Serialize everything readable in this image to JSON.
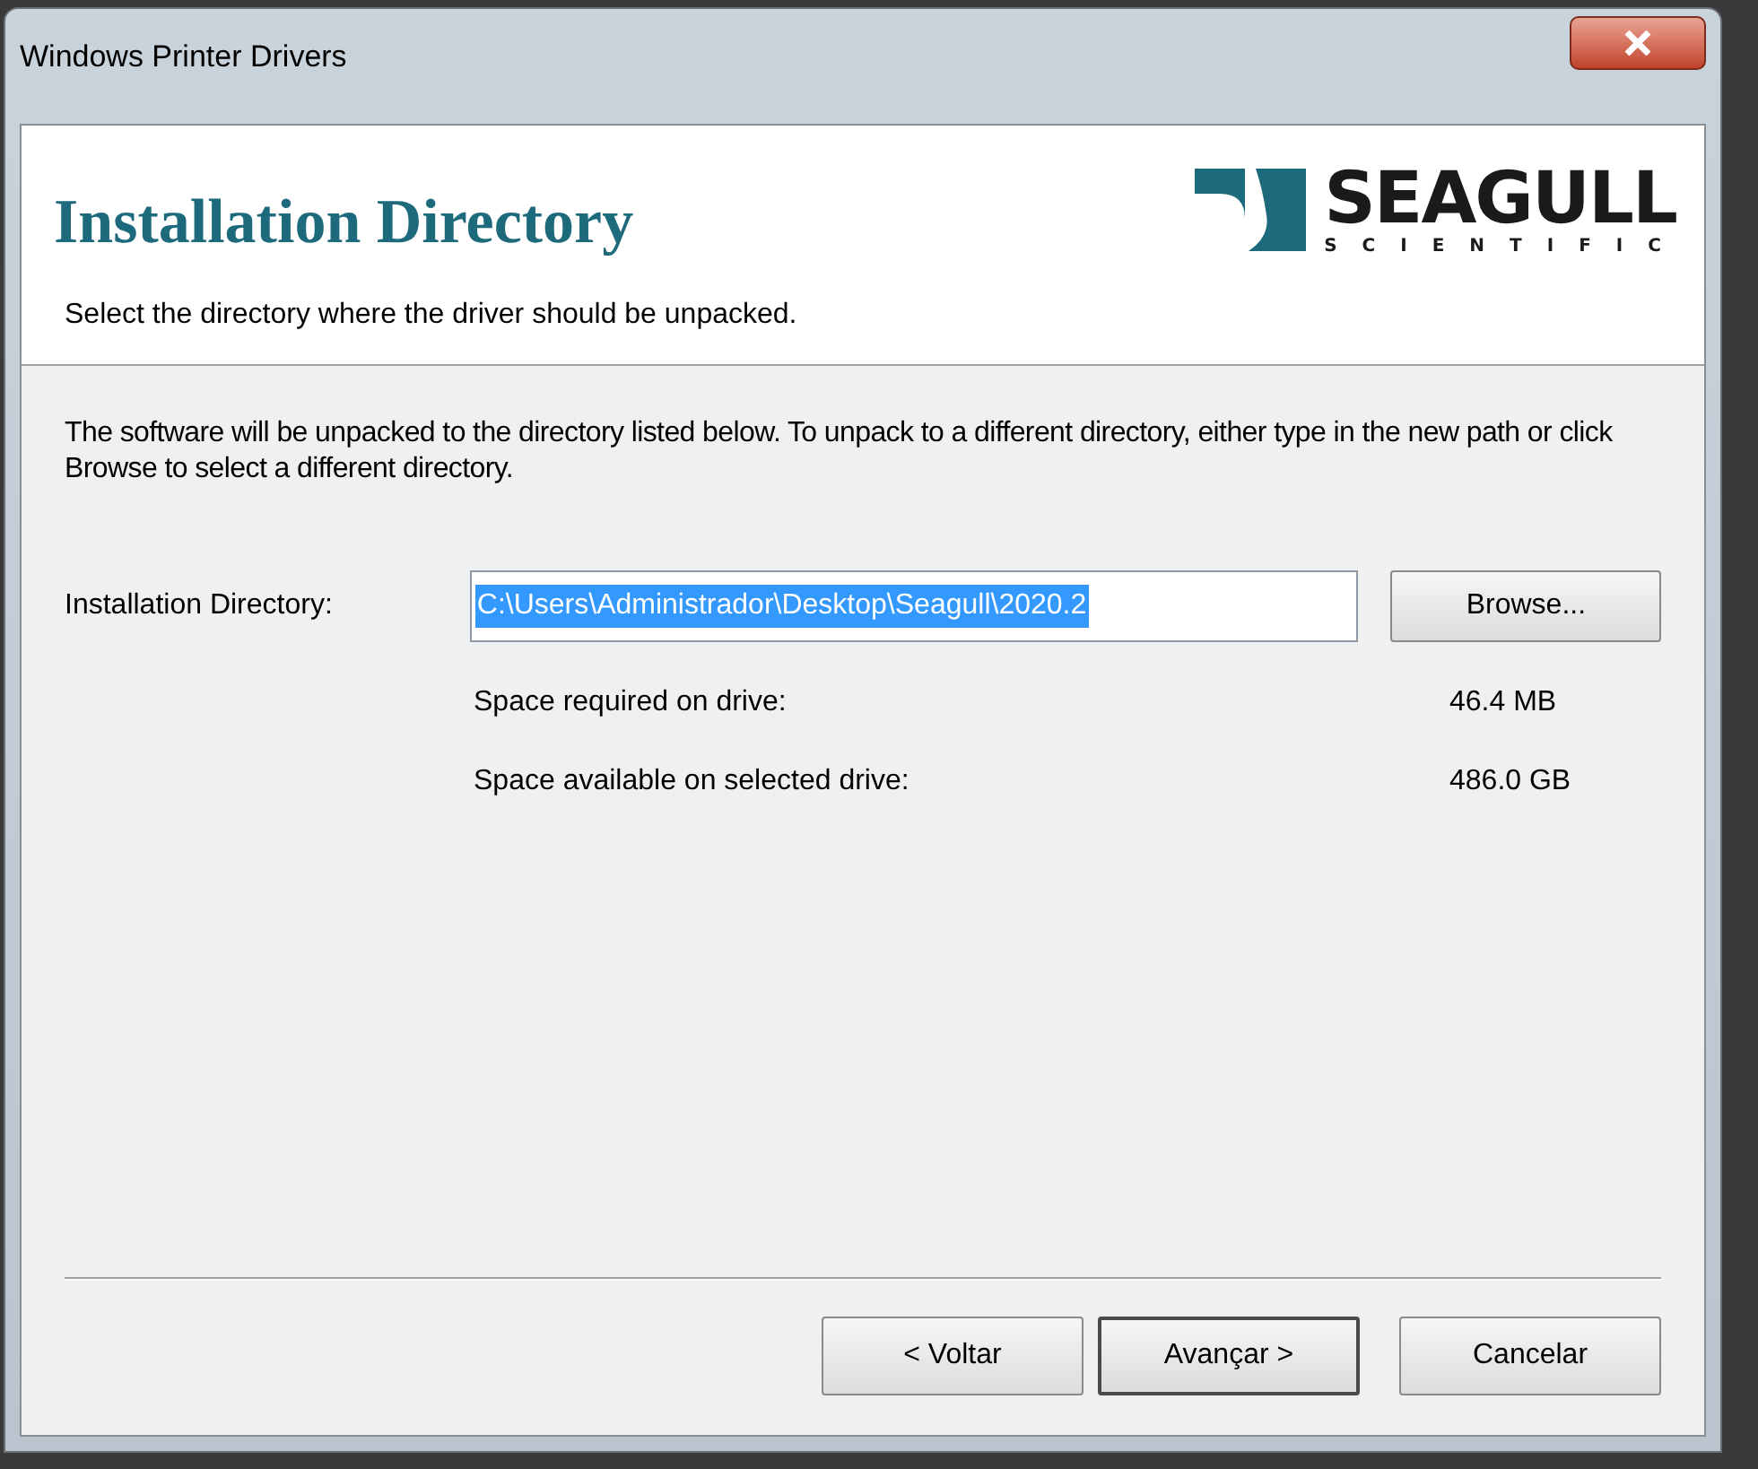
{
  "window": {
    "title": "Windows Printer Drivers"
  },
  "header": {
    "title": "Installation Directory",
    "subtitle": "Select the directory where the driver should be unpacked.",
    "logo": {
      "name": "SEAGULL",
      "tagline": "SCIENTIFIC"
    }
  },
  "intro": "The software will be unpacked to the directory listed below.  To unpack to a different directory, either type in the new path or click Browse to select a different directory.",
  "directory": {
    "label": "Installation Directory:",
    "value": "C:\\Users\\Administrador\\Desktop\\Seagull\\2020.2",
    "text_selected": true,
    "browse": "Browse..."
  },
  "space": [
    {
      "label": "Space required on drive:",
      "value": "46.4 MB"
    },
    {
      "label": "Space available on selected drive:",
      "value": "486.0 GB"
    }
  ],
  "buttons": [
    {
      "label": "< Voltar",
      "default": false
    },
    {
      "label": "Avançar >",
      "default": true
    },
    {
      "label": "Cancelar",
      "default": false
    }
  ]
}
